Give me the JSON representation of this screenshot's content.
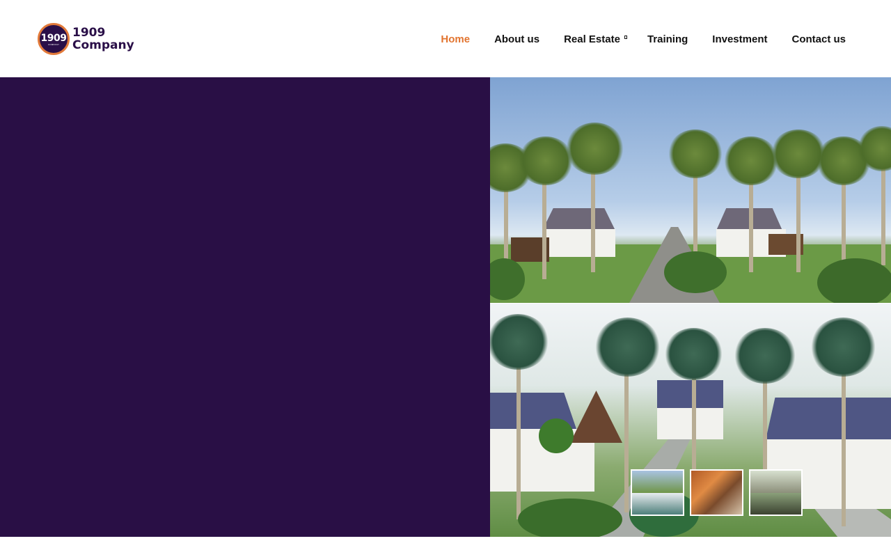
{
  "brand": {
    "badge_number": "1909",
    "badge_sub": "COMPANY",
    "line1": "1909",
    "line2": "Company"
  },
  "nav": {
    "items": [
      {
        "label": "Home",
        "active": true
      },
      {
        "label": "About us"
      },
      {
        "label": "Real Estate",
        "has_dropdown": true
      },
      {
        "label": "Training"
      },
      {
        "label": "Investment"
      },
      {
        "label": "Contact us"
      }
    ]
  },
  "colors": {
    "brand_purple": "#290f45",
    "accent_orange": "#e2742f",
    "nav_text": "#111111"
  },
  "hero": {
    "thumbnails": [
      {
        "icon": "estate-thumbnail"
      },
      {
        "icon": "poultry-thumbnail"
      },
      {
        "icon": "houses-thumbnail"
      }
    ]
  }
}
